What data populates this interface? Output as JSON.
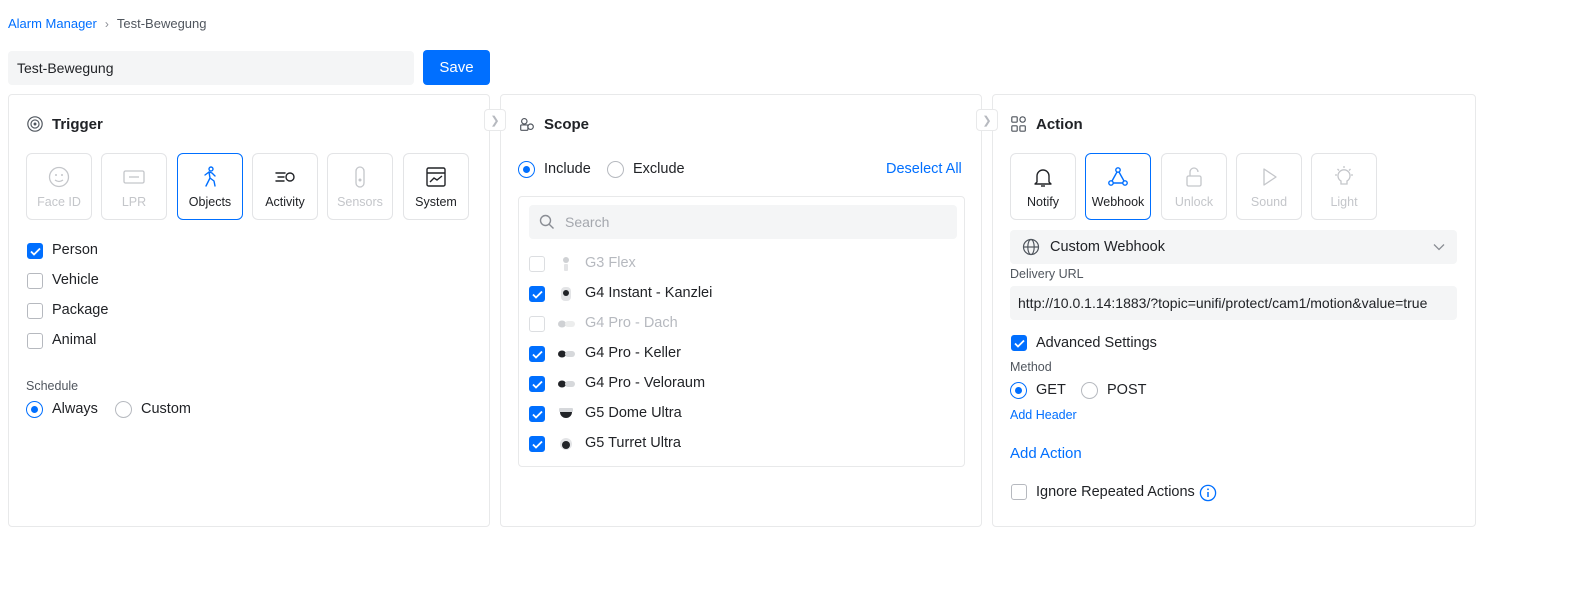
{
  "breadcrumb": {
    "parent": "Alarm Manager",
    "current": "Test-Bewegung"
  },
  "alarm_name": "Test-Bewegung",
  "save_label": "Save",
  "colors": {
    "accent": "#006fff",
    "border": "#e8e9ea",
    "input_bg": "#f4f5f6"
  },
  "trigger": {
    "title": "Trigger",
    "types": [
      {
        "label": "Face ID",
        "icon": "face-icon",
        "state": "disabled"
      },
      {
        "label": "LPR",
        "icon": "license-plate-icon",
        "state": "disabled"
      },
      {
        "label": "Objects",
        "icon": "person-walking-icon",
        "state": "selected"
      },
      {
        "label": "Activity",
        "icon": "activity-motion-icon",
        "state": "normal"
      },
      {
        "label": "Sensors",
        "icon": "sensor-icon",
        "state": "disabled"
      },
      {
        "label": "System",
        "icon": "system-icon",
        "state": "normal"
      }
    ],
    "objects": [
      {
        "label": "Person",
        "checked": true
      },
      {
        "label": "Vehicle",
        "checked": false
      },
      {
        "label": "Package",
        "checked": false
      },
      {
        "label": "Animal",
        "checked": false
      }
    ],
    "schedule_label": "Schedule",
    "schedule_options": [
      {
        "label": "Always",
        "selected": true
      },
      {
        "label": "Custom",
        "selected": false
      }
    ]
  },
  "scope": {
    "title": "Scope",
    "include_label": "Include",
    "exclude_label": "Exclude",
    "mode": "include",
    "deselect_all": "Deselect All",
    "search_placeholder": "Search",
    "cameras": [
      {
        "name": "G3 Flex",
        "checked": false,
        "disabled": true,
        "icon": "camera-flex-icon"
      },
      {
        "name": "G4 Instant - Kanzlei",
        "checked": true,
        "disabled": false,
        "icon": "camera-instant-icon"
      },
      {
        "name": "G4 Pro - Dach",
        "checked": false,
        "disabled": true,
        "icon": "camera-pro-icon"
      },
      {
        "name": "G4 Pro - Keller",
        "checked": true,
        "disabled": false,
        "icon": "camera-pro-icon"
      },
      {
        "name": "G4 Pro - Veloraum",
        "checked": true,
        "disabled": false,
        "icon": "camera-pro-icon"
      },
      {
        "name": "G5 Dome Ultra",
        "checked": true,
        "disabled": false,
        "icon": "camera-dome-icon"
      },
      {
        "name": "G5 Turret Ultra",
        "checked": true,
        "disabled": false,
        "icon": "camera-turret-icon"
      }
    ]
  },
  "action": {
    "title": "Action",
    "types": [
      {
        "label": "Notify",
        "icon": "bell-icon",
        "state": "normal"
      },
      {
        "label": "Webhook",
        "icon": "webhook-icon",
        "state": "selected"
      },
      {
        "label": "Unlock",
        "icon": "unlock-icon",
        "state": "disabled"
      },
      {
        "label": "Sound",
        "icon": "play-icon",
        "state": "disabled"
      },
      {
        "label": "Light",
        "icon": "light-bulb-icon",
        "state": "disabled"
      }
    ],
    "webhook_type": "Custom Webhook",
    "delivery_url_label": "Delivery URL",
    "delivery_url": "http://10.0.1.14:1883/?topic=unifi/protect/cam1/motion&value=true",
    "advanced_settings_label": "Advanced Settings",
    "advanced_settings_checked": true,
    "method_label": "Method",
    "methods": [
      {
        "label": "GET",
        "selected": true
      },
      {
        "label": "POST",
        "selected": false
      }
    ],
    "add_header": "Add Header",
    "add_action": "Add Action",
    "ignore_repeated_label": "Ignore Repeated Actions",
    "ignore_repeated_checked": false
  }
}
